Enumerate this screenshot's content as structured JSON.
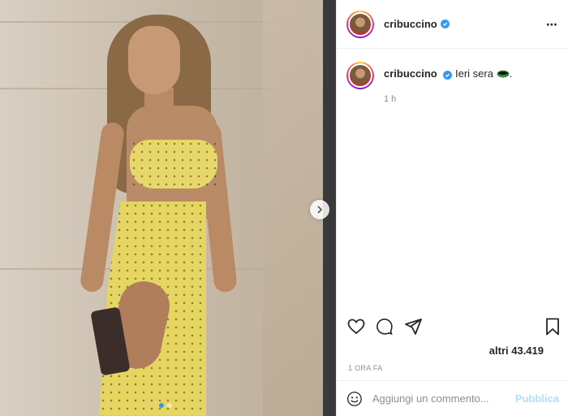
{
  "post": {
    "username": "cribuccino",
    "caption_user": "cribuccino",
    "caption_text": "Ieri sera",
    "caption_emoji": "sunglasses-emoji",
    "caption_suffix": ".",
    "caption_time": "1 h",
    "likes": "altri 43.419",
    "date": "1 ORA FA",
    "carousel": {
      "count": 2,
      "active": 0
    }
  },
  "comment": {
    "placeholder": "Aggiungi un commento...",
    "publish_label": "Pubblica"
  },
  "icons": {
    "more": "more-options-icon",
    "verified": "verified-badge-icon",
    "like": "heart-icon",
    "comment": "comment-icon",
    "share": "paper-plane-icon",
    "save": "bookmark-icon",
    "emoji": "smiley-icon",
    "next": "chevron-right-icon"
  },
  "colors": {
    "accent": "#3897f0",
    "publish_disabled": "#b2dffc",
    "muted": "#8e8e8e"
  }
}
